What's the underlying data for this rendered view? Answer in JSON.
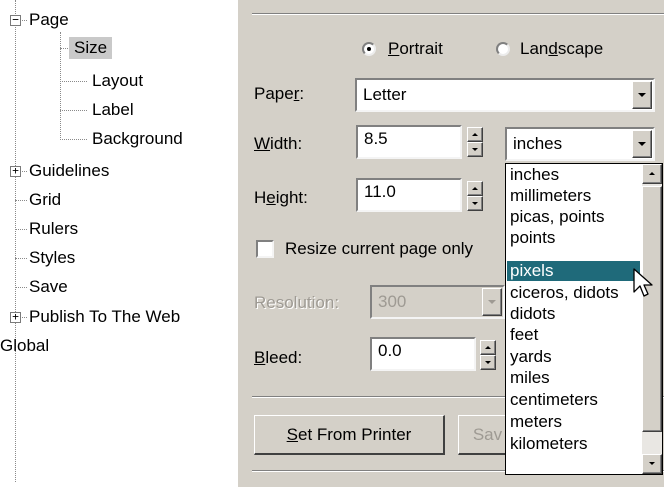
{
  "tree": {
    "items": [
      {
        "label": "Page",
        "expander": "−"
      },
      {
        "label": "Size"
      },
      {
        "label": "Layout"
      },
      {
        "label": "Label"
      },
      {
        "label": "Background"
      },
      {
        "label": "Guidelines",
        "expander": "+"
      },
      {
        "label": "Grid"
      },
      {
        "label": "Rulers"
      },
      {
        "label": "Styles"
      },
      {
        "label": "Save"
      },
      {
        "label": "Publish To The Web",
        "expander": "+"
      },
      {
        "label": "Global"
      }
    ],
    "selected": "Size"
  },
  "orientation": {
    "portrait_label": "Portrait",
    "landscape_label": "Landscape",
    "selected": "Portrait"
  },
  "paper": {
    "label": "Paper:",
    "value": "Letter"
  },
  "width": {
    "label": "Width:",
    "value": "8.5"
  },
  "units": {
    "value": "inches",
    "options": [
      "inches",
      "millimeters",
      "picas, points",
      "points",
      "pixels",
      "ciceros, didots",
      "didots",
      "feet",
      "yards",
      "miles",
      "centimeters",
      "meters",
      "kilometers"
    ],
    "highlighted": "pixels"
  },
  "height": {
    "label": "Height:",
    "value": "11.0"
  },
  "resize_checkbox": {
    "label": "Resize current page only",
    "checked": false
  },
  "resolution": {
    "label": "Resolution:",
    "value": "300"
  },
  "bleed": {
    "label": "Bleed:",
    "value": "0.0"
  },
  "buttons": {
    "set_from_printer": "Set From Printer",
    "save_partial": "Sav"
  },
  "colors": {
    "panel_bg": "#d4d0c8",
    "selection": "#1f6a7a",
    "tree_selection": "#c9c9c9"
  }
}
